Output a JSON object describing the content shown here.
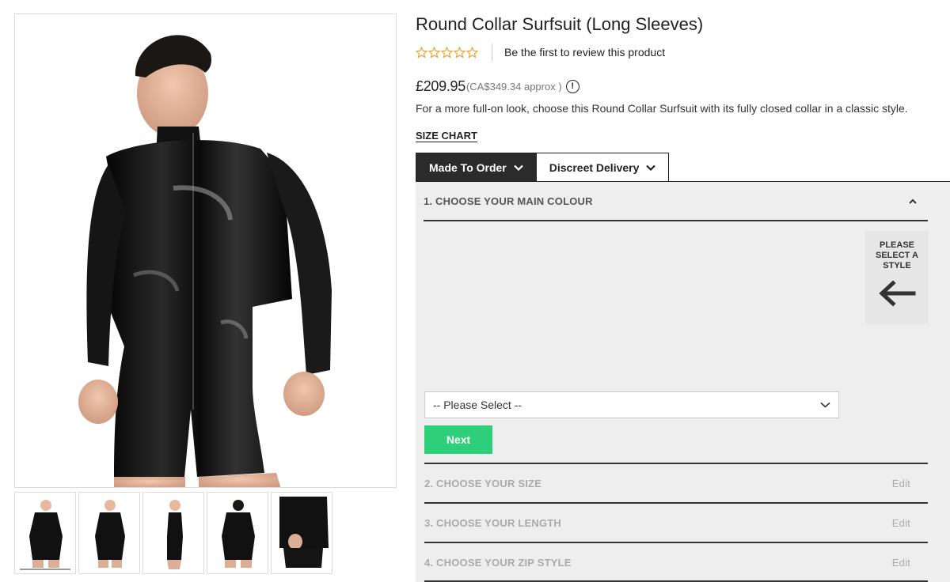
{
  "product": {
    "title": "Round Collar Surfsuit (Long Sleeves)",
    "rating_stars": 0,
    "rating_max": 5,
    "review_link": "Be the first to review this product",
    "price": "£209.95",
    "price_approx": "(CA$349.34 approx )",
    "description": "For a more full-on look, choose this Round Collar Surfsuit with its fully closed collar in a classic style.",
    "size_chart_label": "SIZE CHART"
  },
  "gallery": {
    "thumbnail_count": 5,
    "active_thumbnail": 1
  },
  "tabs": [
    {
      "label": "Made To Order",
      "active": true
    },
    {
      "label": "Discreet Delivery",
      "active": false
    }
  ],
  "config": {
    "step1": {
      "title": "1. CHOOSE YOUR MAIN COLOUR",
      "style_hint": "PLEASE SELECT A STYLE",
      "select_placeholder": "-- Please Select --",
      "next_label": "Next"
    },
    "steps": [
      {
        "title": "2. CHOOSE YOUR SIZE",
        "edit": "Edit"
      },
      {
        "title": "3. CHOOSE YOUR LENGTH",
        "edit": "Edit"
      },
      {
        "title": "4. CHOOSE YOUR ZIP STYLE",
        "edit": "Edit"
      }
    ],
    "swatch_colors": [
      "#e8332f",
      "#f9b8c0",
      "#0c0c0c",
      "#c4541e",
      "#f59bbf",
      "#b4591f",
      "#4a2617",
      "#3b1d4a",
      "#6494b0",
      "#a18c95",
      "#a43a48",
      "#25d3c4",
      "#7ac3e1",
      "#f7b3e0",
      "#f7c99e",
      "#3a64a8",
      "#a2957a",
      "#f579b3",
      "#1f8a47",
      "#8a8a8a",
      "#b8782a",
      "#3e5e7e",
      "#15525e",
      "#808080",
      "#a59a85",
      "#5a2ba0",
      "#c11a3c",
      "#2955b8",
      "#2e7a1e",
      "#162d55",
      "#2c4a1a",
      "#f77b12",
      "#e4a3cb",
      "#e8a1cb",
      "#22bfa8",
      "#d6b240",
      "#a3a3a3",
      "#76102e",
      "#d9184a",
      "#e01818",
      "#1a2ee0",
      "#b8b69a",
      "#f8c1c8",
      "#f7c3c7",
      "#18c21a",
      "#f02b7a",
      "#f74413",
      "#e61410",
      "#e8e60c",
      "#8f9187",
      "#8a2be2",
      "#c88266",
      "#b684f5",
      "#1c6aa0",
      "#b36b9f",
      "#edceb2",
      "#394a3a",
      "#c8957e",
      "#5a4a42",
      "#16aab8",
      "#f27bb0",
      "#f7f4e6",
      "#f7f20c"
    ]
  }
}
